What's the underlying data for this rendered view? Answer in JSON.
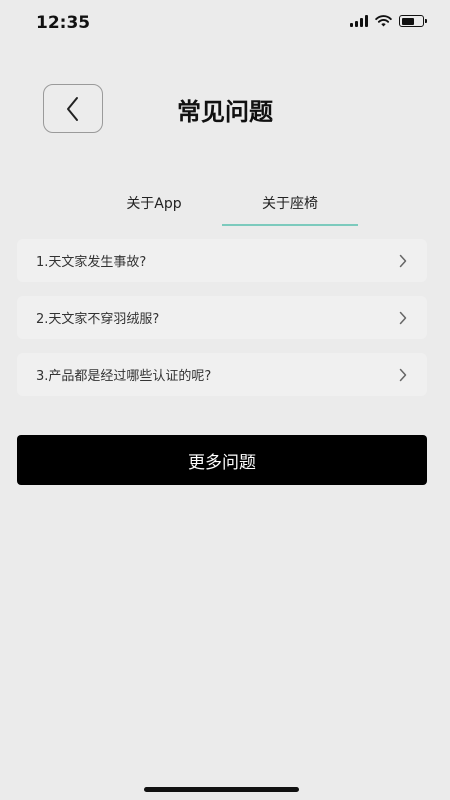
{
  "status_bar": {
    "time": "12:35",
    "battery_level": 0.6,
    "icons": [
      "signal-icon",
      "wifi-icon",
      "battery-icon"
    ]
  },
  "header": {
    "title": "常见问题",
    "back_icon": "chevron-left-icon"
  },
  "tabs": [
    {
      "label": "关于App",
      "active": false
    },
    {
      "label": "关于座椅",
      "active": true
    }
  ],
  "faq": [
    {
      "text": "1.天文家发生事故?"
    },
    {
      "text": "2.天文家不穿羽绒服?"
    },
    {
      "text": "3.产品都是经过哪些认证的呢?"
    }
  ],
  "more_button": {
    "label": "更多问题"
  },
  "colors": {
    "background": "#ebebeb",
    "tab_indicator": "#7ccabd",
    "primary_button": "#000000"
  }
}
